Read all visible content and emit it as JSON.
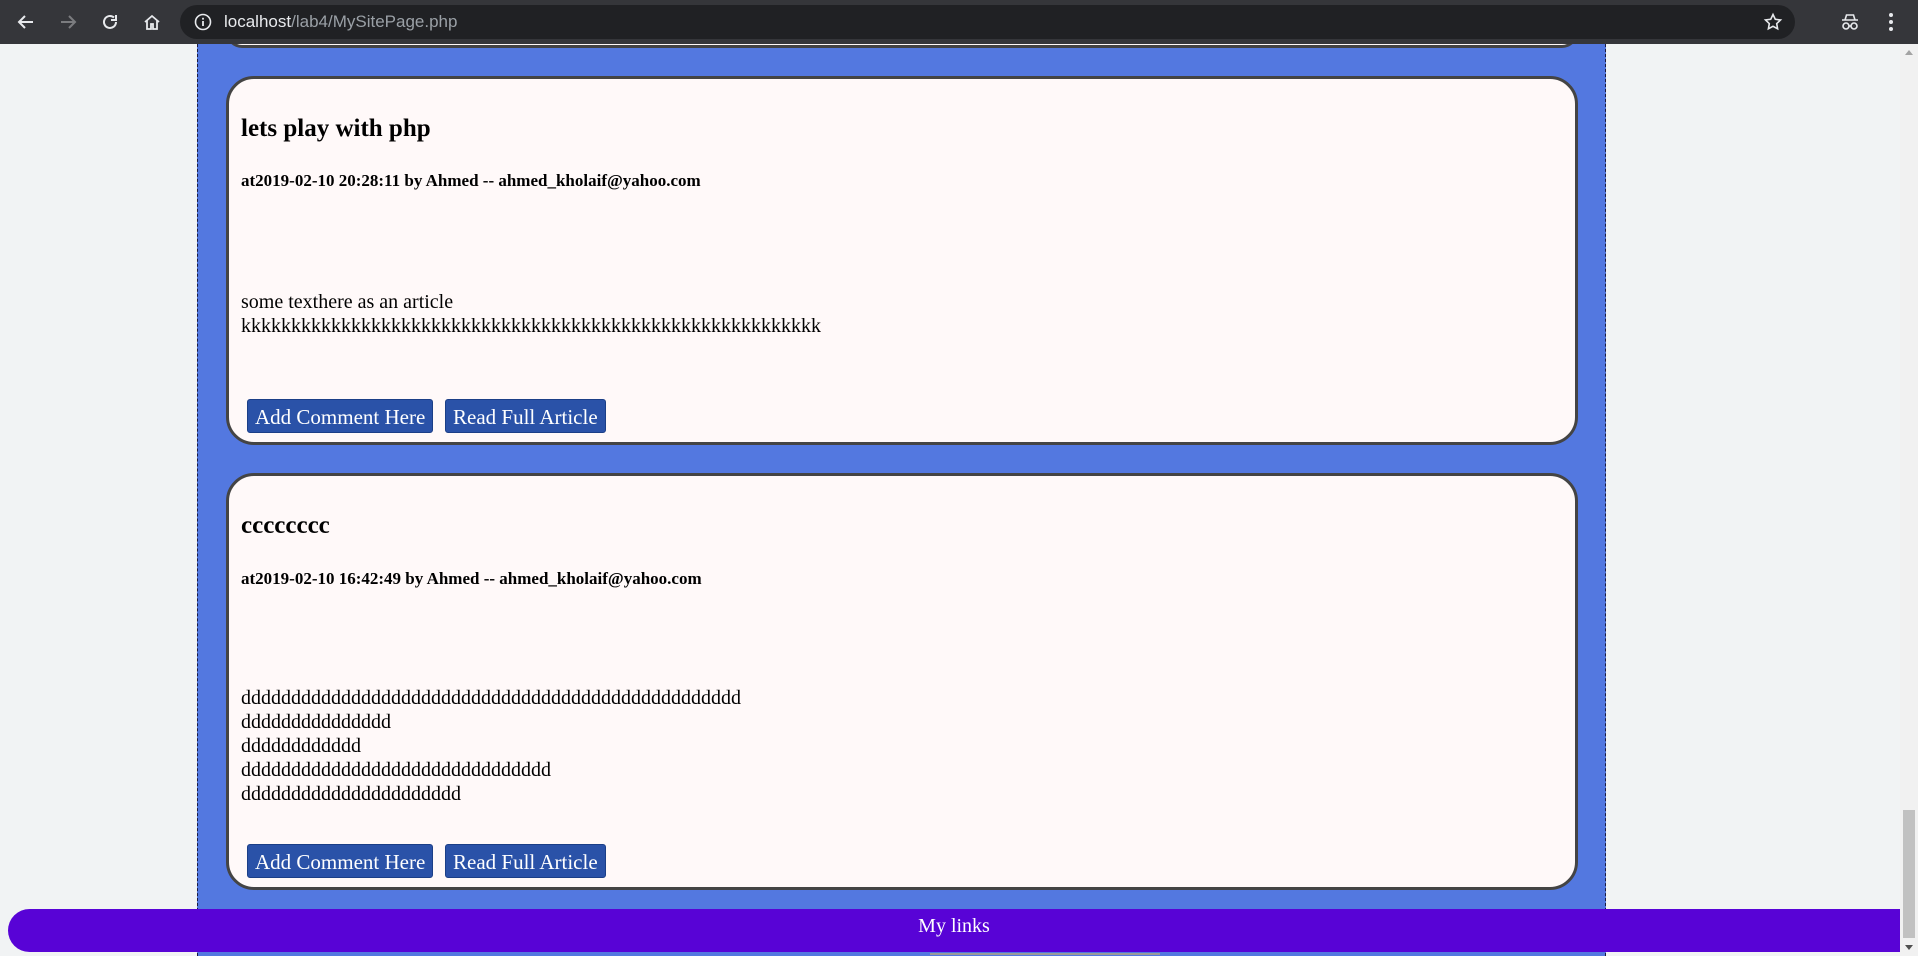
{
  "browser": {
    "url_host": "localhost",
    "url_path": "/lab4/MySitePage.php",
    "icons": [
      "back-icon",
      "forward-icon",
      "reload-icon",
      "home-icon",
      "info-icon",
      "star-icon",
      "incognito-icon",
      "menu-icon"
    ]
  },
  "articles": [
    {
      "title": "lets play with php",
      "meta": "at2019-02-10 20:28:11 by Ahmed -- ahmed_kholaif@yahoo.com",
      "body_lines": [
        "some texthere as an article",
        "kkkkkkkkkkkkkkkkkkkkkkkkkkkkkkkkkkkkkkkkkkkkkkkkkkkkkkkkkk"
      ],
      "comment_label": "Add Comment Here",
      "read_label": "Read Full Article"
    },
    {
      "title": "cccccccc",
      "meta": "at2019-02-10 16:42:49 by Ahmed -- ahmed_kholaif@yahoo.com",
      "body_lines": [
        "dddddddddddddddddddddddddddddddddddddddddddddddddd",
        "ddddddddddddddd",
        "dddddddddddd",
        "ddddddddddddddddddddddddddddddd",
        "dddddddddddddddddddddd"
      ],
      "comment_label": "Add Comment Here",
      "read_label": "Read Full Article"
    }
  ],
  "footer": {
    "label": "My links"
  },
  "colors": {
    "page_column": "#5378e0",
    "card_bg": "#fff9f9",
    "button": "#2a52a8",
    "footer": "#5803d6"
  }
}
